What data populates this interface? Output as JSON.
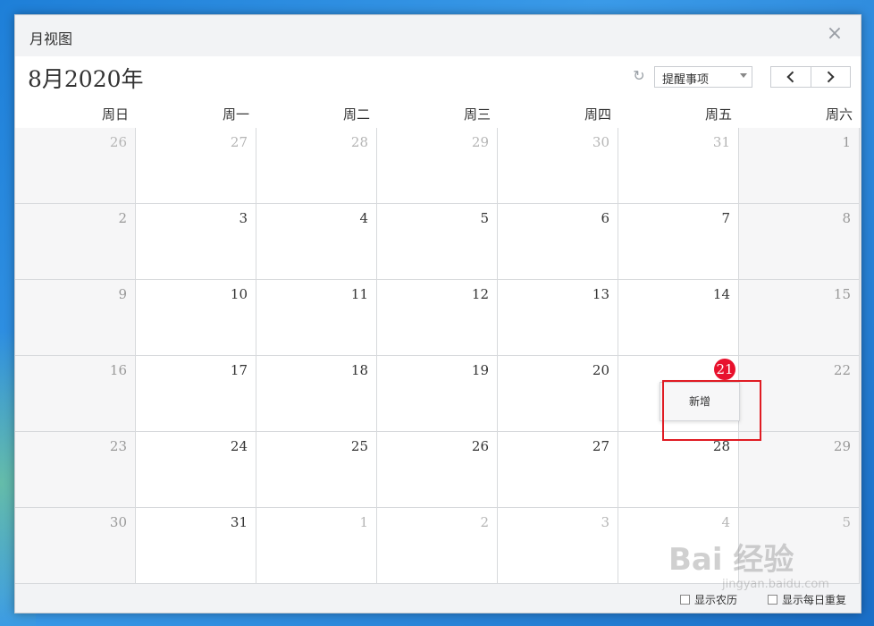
{
  "window": {
    "title": "月视图",
    "close_glyph": "×"
  },
  "toolbar": {
    "month_label": "8月2020年",
    "refresh_icon": "refresh-icon",
    "filter_select_value": "提醒事项",
    "prev_icon": "chevron-left-icon",
    "next_icon": "chevron-right-icon"
  },
  "weekdays": [
    "周日",
    "周一",
    "周二",
    "周三",
    "周四",
    "周五",
    "周六"
  ],
  "days": [
    {
      "n": "26",
      "other": true
    },
    {
      "n": "27",
      "other": true
    },
    {
      "n": "28",
      "other": true
    },
    {
      "n": "29",
      "other": true
    },
    {
      "n": "30",
      "other": true
    },
    {
      "n": "31",
      "other": true
    },
    {
      "n": "1",
      "other": false
    },
    {
      "n": "2",
      "other": false
    },
    {
      "n": "3",
      "other": false
    },
    {
      "n": "4",
      "other": false
    },
    {
      "n": "5",
      "other": false
    },
    {
      "n": "6",
      "other": false
    },
    {
      "n": "7",
      "other": false
    },
    {
      "n": "8",
      "other": false
    },
    {
      "n": "9",
      "other": false
    },
    {
      "n": "10",
      "other": false
    },
    {
      "n": "11",
      "other": false
    },
    {
      "n": "12",
      "other": false
    },
    {
      "n": "13",
      "other": false
    },
    {
      "n": "14",
      "other": false
    },
    {
      "n": "15",
      "other": false
    },
    {
      "n": "16",
      "other": false
    },
    {
      "n": "17",
      "other": false
    },
    {
      "n": "18",
      "other": false
    },
    {
      "n": "19",
      "other": false
    },
    {
      "n": "20",
      "other": false
    },
    {
      "n": "21",
      "other": false,
      "today": true
    },
    {
      "n": "22",
      "other": false
    },
    {
      "n": "23",
      "other": false
    },
    {
      "n": "24",
      "other": false
    },
    {
      "n": "25",
      "other": false
    },
    {
      "n": "26",
      "other": false
    },
    {
      "n": "27",
      "other": false
    },
    {
      "n": "28",
      "other": false
    },
    {
      "n": "29",
      "other": false
    },
    {
      "n": "30",
      "other": false
    },
    {
      "n": "31",
      "other": false
    },
    {
      "n": "1",
      "other": true
    },
    {
      "n": "2",
      "other": true
    },
    {
      "n": "3",
      "other": true
    },
    {
      "n": "4",
      "other": true
    },
    {
      "n": "5",
      "other": true
    }
  ],
  "popup": {
    "add_label": "新增"
  },
  "footer": {
    "show_lunar": "显示农历",
    "show_daily_repeat": "显示每日重复"
  },
  "colors": {
    "today_badge": "#e8112d",
    "highlight_border": "#e01b23"
  },
  "watermark": {
    "main": "Bai 经验",
    "sub": "jingyan.baidu.com"
  }
}
